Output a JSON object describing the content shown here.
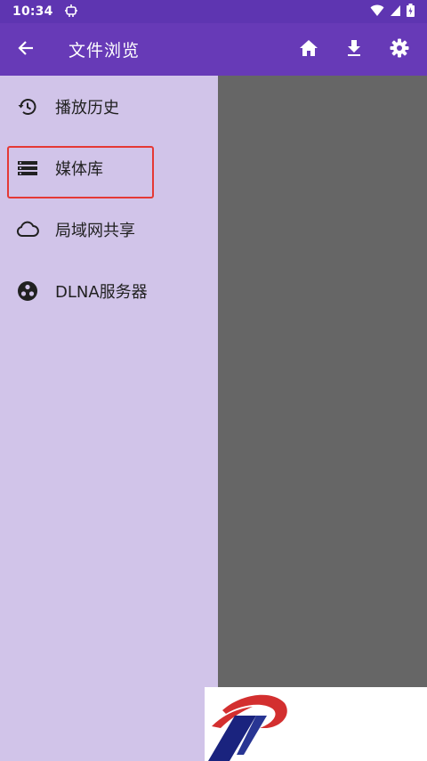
{
  "status_bar": {
    "time": "10:34",
    "notification_icon": "robot-icon",
    "wifi_icon": "wifi-icon",
    "battery_icon": "battery-charging-icon"
  },
  "app_bar": {
    "title": "文件浏览",
    "back_icon": "arrow-back-icon",
    "actions": [
      "home-icon",
      "download-icon",
      "settings-icon"
    ],
    "color": "#673ab7"
  },
  "drawer": {
    "background": "#d1c4e9",
    "items": [
      {
        "label": "播放历史",
        "icon": "history-icon"
      },
      {
        "label": "媒体库",
        "icon": "storage-icon",
        "highlighted": true
      },
      {
        "label": "局域网共享",
        "icon": "cloud-icon"
      },
      {
        "label": "DLNA服务器",
        "icon": "dlna-icon"
      }
    ]
  },
  "highlight_color": "#e53935",
  "watermark": {
    "icon": "brand-logo-icon"
  }
}
